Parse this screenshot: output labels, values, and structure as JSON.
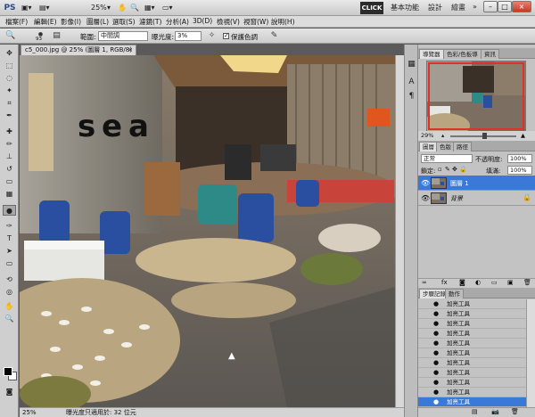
{
  "app": {
    "logo": "PS",
    "controls": [
      "▣▾",
      "▤▾",
      "25%",
      "▾",
      "✋",
      "🔍",
      "▦▾",
      "▭▾"
    ],
    "click_label": "CLICK",
    "workspaces": [
      "基本功能",
      "設計",
      "繪畫",
      "»"
    ],
    "window_buttons": [
      "–",
      "□",
      "×"
    ]
  },
  "menu": [
    "檔案(F)",
    "編輯(E)",
    "影像(I)",
    "圖層(L)",
    "選取(S)",
    "濾鏡(T)",
    "分析(A)",
    "3D(D)",
    "檢視(V)",
    "視窗(W)",
    "說明(H)"
  ],
  "options": {
    "brush_size": "93",
    "range_label": "範圍:",
    "range_value": "中間調",
    "exposure_label": "曝光度:",
    "exposure_value": "3%",
    "protect_tones_label": "保護色調",
    "protect_tones_checked": true
  },
  "document": {
    "tab_title": "c5_000.jpg @ 25% (圖層 1, RGB/8) *",
    "close": "×",
    "canvas_words": [
      "s",
      "e",
      "a"
    ]
  },
  "status": {
    "zoom": "25%",
    "info": "曝光度只適用於: 32 位元"
  },
  "navigator": {
    "tabs": [
      "導覽器",
      "色彩/色板導",
      "資訊"
    ],
    "zoom": "29%"
  },
  "layers": {
    "tabs": [
      "圖層",
      "色版",
      "路徑"
    ],
    "blend_mode": "正常",
    "opacity_label": "不透明度:",
    "opacity_value": "100%",
    "lock_label": "鎖定:",
    "fill_label": "填滿:",
    "fill_value": "100%",
    "rows": [
      {
        "name": "圖層 1",
        "selected": true
      },
      {
        "name": "背景",
        "selected": false
      }
    ]
  },
  "history": {
    "tabs": [
      "步驟記錄",
      "動作"
    ],
    "items": [
      "加亮工具",
      "加亮工具",
      "加亮工具",
      "加亮工具",
      "加亮工具",
      "加亮工具",
      "加亮工具",
      "加亮工具",
      "加亮工具",
      "加亮工具",
      "加亮工具"
    ],
    "selected_index": 10
  },
  "colors": {
    "selection": "#3a79d8",
    "nav_box": "#e0302a"
  }
}
